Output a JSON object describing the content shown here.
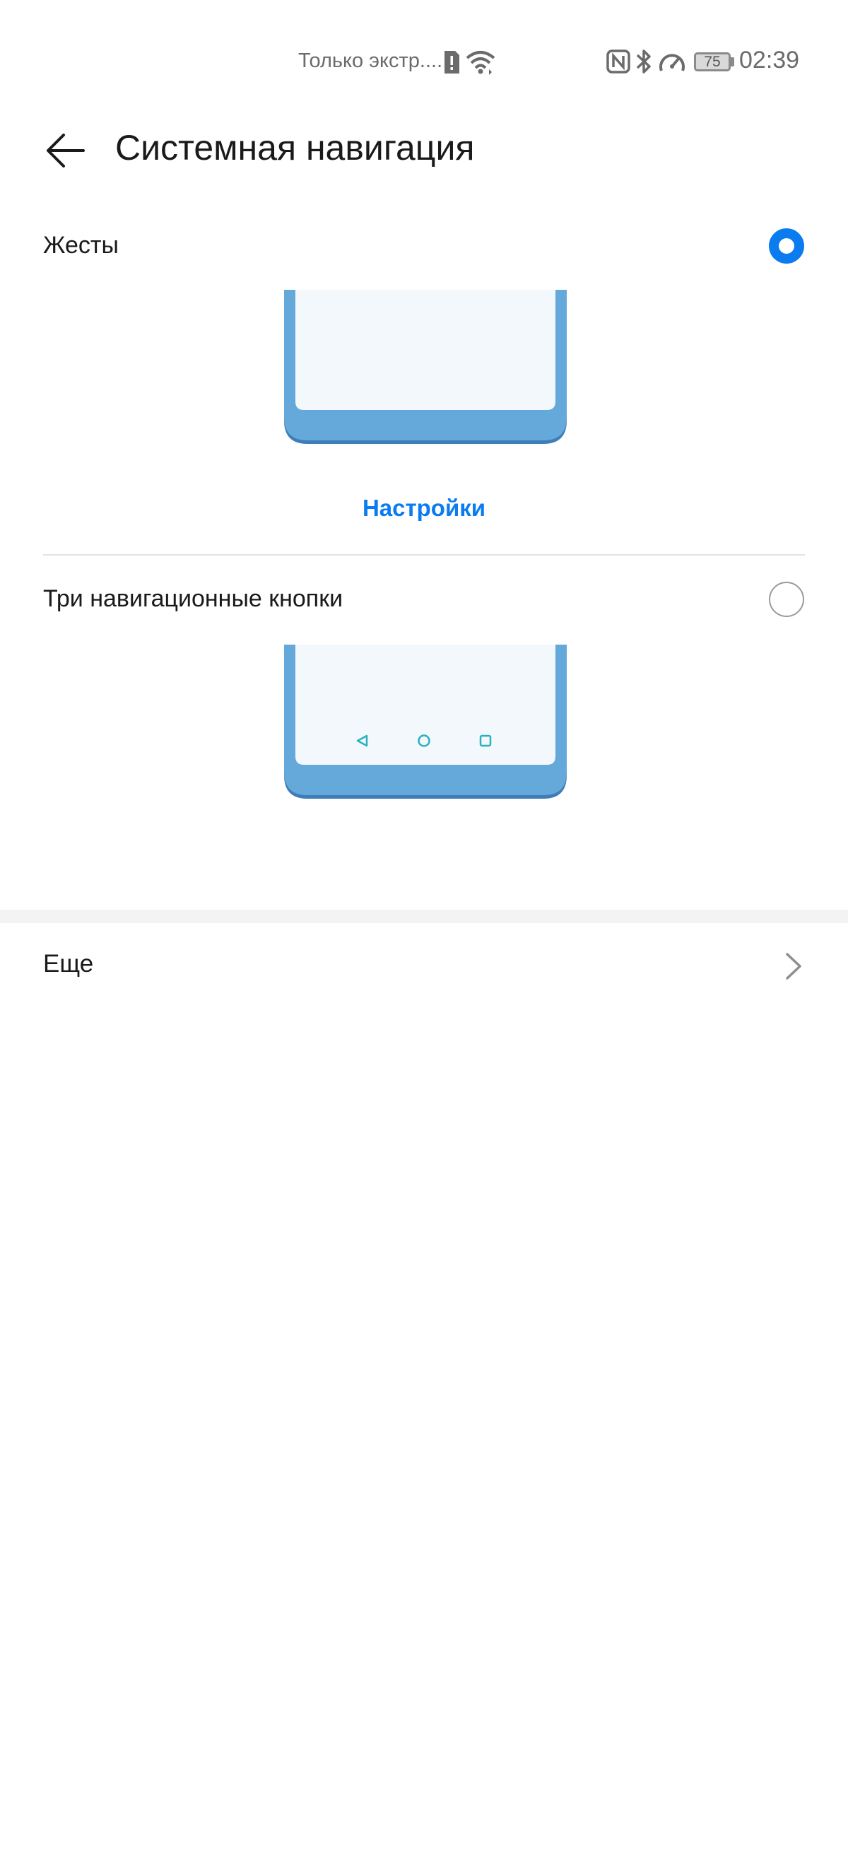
{
  "status_bar": {
    "carrier": "Только экстр....",
    "battery_level": "75",
    "time": "02:39",
    "icons": [
      "sim-alert-icon",
      "wifi-icon",
      "nfc-icon",
      "bluetooth-icon",
      "speedometer-icon",
      "battery-icon"
    ]
  },
  "header": {
    "title": "Системная навигация",
    "back_icon": "arrow-left-icon"
  },
  "options": [
    {
      "label": "Жесты",
      "selected": true,
      "link": "Настройки"
    },
    {
      "label": "Три навигационные кнопки",
      "selected": false
    }
  ],
  "more": {
    "label": "Еще",
    "icon": "chevron-right-icon"
  },
  "colors": {
    "accent": "#0a7cf0",
    "phone_frame": "#65a9da",
    "phone_screen": "#f2f8fc",
    "nav_glyph": "#2bb0bf"
  }
}
